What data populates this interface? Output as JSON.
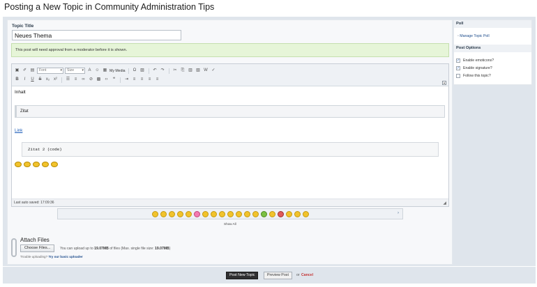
{
  "page": {
    "title": "Posting a New Topic in Community Administration Tips"
  },
  "form": {
    "topic_title_label": "Topic Title",
    "topic_title_value": "Neues Thema",
    "notice": "This post will need approval from a moderator before it is shown."
  },
  "toolbar": {
    "font_placeholder": "Font",
    "size_placeholder": "Size",
    "my_media_label": "My Media"
  },
  "editor": {
    "line1": "Inhalt",
    "quote": "Zitat",
    "link": "Link",
    "code": "Zitat 2 (code)",
    "autosave": "Last auto saved: 17:09:36"
  },
  "smilies": {
    "show_all": "Show All"
  },
  "attachments": {
    "title": "Attach Files",
    "choose_button": "Choose Files...",
    "info_prefix": "You can upload up to ",
    "info_size": "19.07MB",
    "info_middle": " of files (Max. single file size: ",
    "info_single": "19.07MB",
    "info_suffix": ")",
    "trouble_prefix": "Trouble uploading? ",
    "trouble_link": "Try our basic uploader"
  },
  "sidebar": {
    "poll_header": "Poll",
    "manage_poll": "Manage Topic Poll",
    "options_header": "Post Options",
    "options": [
      {
        "label": "Enable emoticons?",
        "checked": true
      },
      {
        "label": "Enable signature?",
        "checked": true
      },
      {
        "label": "Follow this topic?",
        "checked": false
      }
    ]
  },
  "footer": {
    "post_button": "Post New Topic",
    "preview_button": "Preview Post",
    "or_text": "or",
    "cancel_link": "Cancel"
  }
}
